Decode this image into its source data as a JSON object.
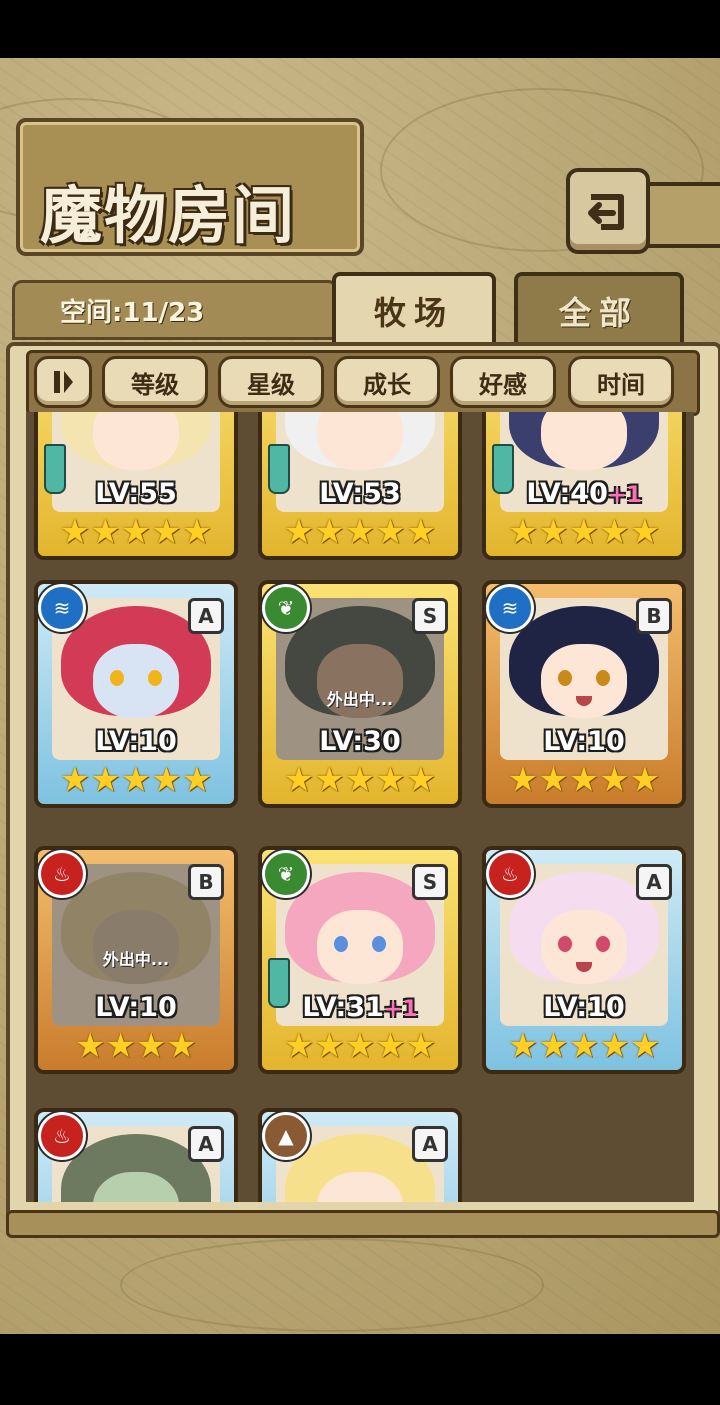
{
  "header": {
    "title": "魔物房间"
  },
  "space": {
    "label": "空间:11/23"
  },
  "tabs": [
    {
      "label": "牧场"
    },
    {
      "label": "全部"
    }
  ],
  "sort_buttons": [
    "等级",
    "星级",
    "成长",
    "好感",
    "时间"
  ],
  "status": {
    "away": "外出中..."
  },
  "cards": [
    {
      "level": "LV:55",
      "bonus": "",
      "stars": 5,
      "rank": ""
    },
    {
      "level": "LV:53",
      "bonus": "",
      "stars": 5,
      "rank": ""
    },
    {
      "level": "LV:40",
      "bonus": "+1",
      "stars": 5,
      "rank": ""
    },
    {
      "level": "LV:10",
      "bonus": "",
      "stars": 5,
      "rank": "A",
      "element": "water"
    },
    {
      "level": "LV:30",
      "bonus": "",
      "stars": 5,
      "rank": "S",
      "element": "leaf",
      "away": true
    },
    {
      "level": "LV:10",
      "bonus": "",
      "stars": 5,
      "rank": "B",
      "element": "water"
    },
    {
      "level": "LV:10",
      "bonus": "",
      "stars": 4,
      "rank": "B",
      "element": "fire",
      "away": true
    },
    {
      "level": "LV:31",
      "bonus": "+1",
      "stars": 5,
      "rank": "S",
      "element": "leaf"
    },
    {
      "level": "LV:10",
      "bonus": "",
      "stars": 5,
      "rank": "A",
      "element": "fire"
    },
    {
      "level": "",
      "bonus": "",
      "stars": 0,
      "rank": "A",
      "element": "fire"
    },
    {
      "level": "",
      "bonus": "",
      "stars": 0,
      "rank": "A",
      "element": "earth"
    }
  ],
  "colors": {
    "accent": "#5a4526",
    "star": "#ffcf26",
    "bonus": "#ff6fb8"
  }
}
